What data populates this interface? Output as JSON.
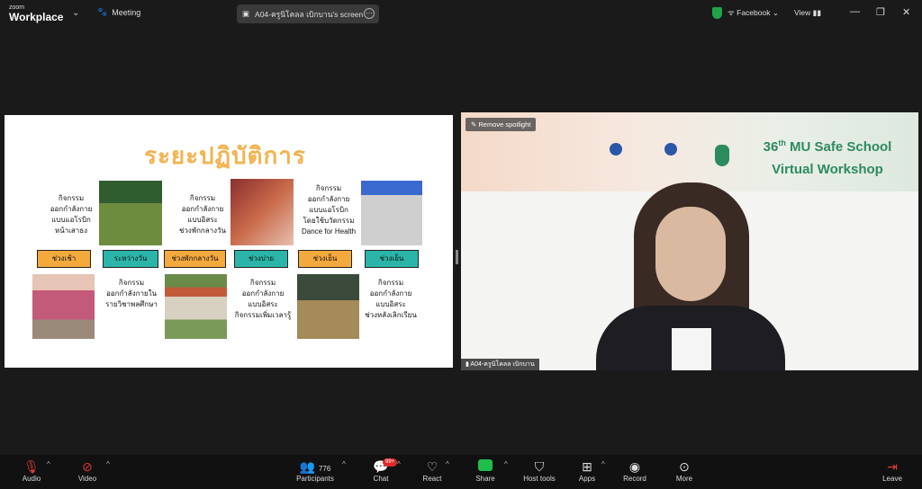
{
  "app": {
    "brand_small": "zoom",
    "brand_big": "Workplace",
    "meeting_label": "Meeting"
  },
  "screen_share": {
    "label": "A04-ครูนิโคลล เบิกบาน's screen"
  },
  "top_right": {
    "facebook_label": "Facebook",
    "view_label": "View"
  },
  "slide": {
    "title": "ระยะปฏิบัติการ",
    "texts_top": [
      "กิจกรรม\nออกกำลังกาย\nแบบแอโรบิก\nหน้าเสาธง",
      "กิจกรรม\nออกกำลังกาย\nแบบอิสระ\nช่วงพักกลางวัน",
      "กิจกรรม\nออกกำลังกาย\nแบบแอโรบิก\nโดยใช้บวัดกรรม\nDance for Health"
    ],
    "buttons": [
      "ช่วงเช้า",
      "ระหว่างวัน",
      "ช่วงพักกลางวัน",
      "ช่วงบ่าย",
      "ช่วงเย็น",
      "ช่วงเย็น"
    ],
    "texts_bottom": [
      "กิจกรรม\nออกกำลังกายใน\nรายวิชาพลศึกษา",
      "กิจกรรม\nออกกำลังกาย\nแบบอิสระ\nกิจกรรมเพิ่มเวลารู้",
      "กิจกรรม\nออกกำลังกาย\nแบบอิสระ\nช่วงหลังเลิกเรียน"
    ]
  },
  "video": {
    "remove_spotlight": "Remove spotlight",
    "workshop_number": "36",
    "workshop_sup": "th",
    "workshop_line1": " MU Safe School",
    "workshop_line2": "Virtual Workshop",
    "name_badge": "A04-ครูนิโคลล เบิกบาน"
  },
  "toolbar": {
    "audio": "Audio",
    "video": "Video",
    "participants": "Participants",
    "participants_count": "776",
    "chat": "Chat",
    "chat_badge": "99+",
    "react": "React",
    "share": "Share",
    "host_tools": "Host tools",
    "apps": "Apps",
    "record": "Record",
    "more": "More",
    "leave": "Leave"
  },
  "colors": {
    "accent_orange": "#f4a93d",
    "accent_teal": "#2bb5a8",
    "title_gold": "#f3b34f",
    "workshop_green": "#2d8a5f"
  }
}
